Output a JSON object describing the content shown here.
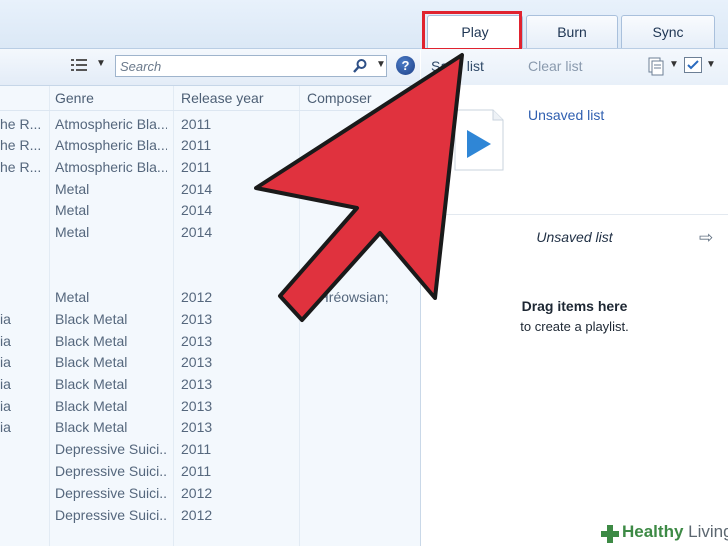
{
  "tabs": {
    "play": "Play",
    "burn": "Burn",
    "sync": "Sync"
  },
  "search": {
    "placeholder": "Search"
  },
  "icons": {
    "view_options": "view-options-icon",
    "search": "search-icon",
    "help": "help-icon",
    "list_options": "list-options-icon",
    "checklist": "checklist-icon",
    "arrow": "arrow-right-icon"
  },
  "colors": {
    "highlight": "#e0232f",
    "arrow_fill": "#e0323e",
    "link": "#2f5fb0",
    "watermark": "#3d8a45"
  },
  "help_label": "?",
  "right_toolbar": {
    "save_list": "Save list",
    "clear_list": "Clear list"
  },
  "columns": {
    "genre": "Genre",
    "release_year": "Release year",
    "composer": "Composer"
  },
  "rows": [
    {
      "c0": "he R...",
      "genre": "Atmospheric Bla...",
      "year": "2011",
      "composer": ""
    },
    {
      "c0": "he R...",
      "genre": "Atmospheric Bla...",
      "year": "2011",
      "composer": ""
    },
    {
      "c0": "he R...",
      "genre": "Atmospheric Bla...",
      "year": "2011",
      "composer": ""
    },
    {
      "c0": "",
      "genre": "Metal",
      "year": "2014",
      "composer": ""
    },
    {
      "c0": "",
      "genre": "Metal",
      "year": "2014",
      "composer": ""
    },
    {
      "c0": "",
      "genre": "Metal",
      "year": "2014",
      "composer": ""
    },
    {
      "c0": "",
      "genre": "Metal",
      "year": "2012",
      "composer": "t; Hréowsian;"
    },
    {
      "c0": "ia",
      "genre": "Black Metal",
      "year": "2013",
      "composer": ""
    },
    {
      "c0": "ia",
      "genre": "Black Metal",
      "year": "2013",
      "composer": ""
    },
    {
      "c0": "ia",
      "genre": "Black Metal",
      "year": "2013",
      "composer": ""
    },
    {
      "c0": "ia",
      "genre": "Black Metal",
      "year": "2013",
      "composer": ""
    },
    {
      "c0": "ia",
      "genre": "Black Metal",
      "year": "2013",
      "composer": ""
    },
    {
      "c0": "ia",
      "genre": "Black Metal",
      "year": "2013",
      "composer": ""
    },
    {
      "c0": "",
      "genre": "Depressive Suici...",
      "year": "2011",
      "composer": ""
    },
    {
      "c0": "",
      "genre": "Depressive Suici...",
      "year": "2011",
      "composer": ""
    },
    {
      "c0": "",
      "genre": "Depressive Suici...",
      "year": "2012",
      "composer": ""
    },
    {
      "c0": "",
      "genre": "Depressive Suici...",
      "year": "2012",
      "composer": ""
    }
  ],
  "playlist": {
    "title": "Unsaved list",
    "subtitle": "Unsaved list",
    "drag_title": "Drag items here",
    "drag_sub": "to create a playlist."
  },
  "watermark": {
    "brand": "Healthy",
    "suffix": "Living"
  }
}
